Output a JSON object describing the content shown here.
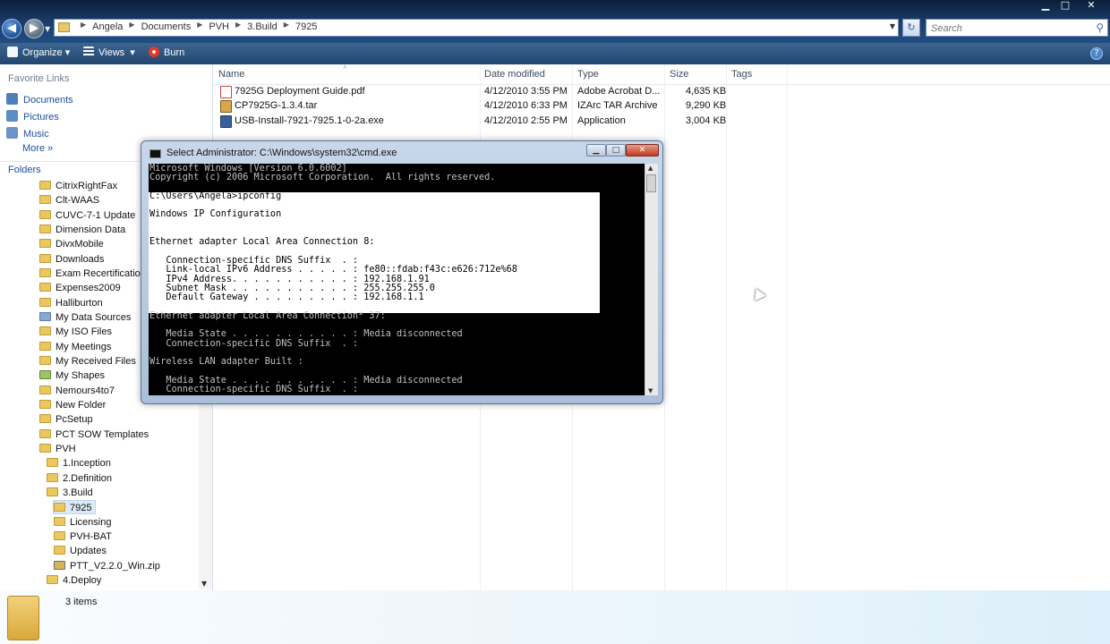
{
  "window": {
    "minimize_glyph": "▁",
    "maximize_glyph": "□",
    "close_glyph": "✕"
  },
  "address_bar": {
    "crumbs": [
      "Angela",
      "Documents",
      "PVH",
      "3.Build",
      "7925"
    ],
    "search_placeholder": "Search"
  },
  "toolbar": {
    "organize": "Organize",
    "views": "Views",
    "burn": "Burn"
  },
  "favorites": {
    "heading": "Favorite Links",
    "items": [
      "Documents",
      "Pictures",
      "Music"
    ],
    "more": "More"
  },
  "folders": {
    "heading": "Folders",
    "items": [
      "CitrixRightFax",
      "Clt-WAAS",
      "CUVC-7-1 Update",
      "Dimension Data",
      "DivxMobile",
      "Downloads",
      "Exam Recertification",
      "Expenses2009",
      "Halliburton",
      "My Data Sources",
      "My ISO Files",
      "My Meetings",
      "My Received Files",
      "My Shapes",
      "Nemours4to7",
      "New Folder",
      "PcSetup",
      "PCT SOW Templates",
      "PVH",
      "1.Inception",
      "2.Definition",
      "3.Build",
      "7925",
      "Licensing",
      "PVH-BAT",
      "Updates",
      "PTT_V2.2.0_Win.zip",
      "4.Deploy"
    ]
  },
  "columns": {
    "name": "Name",
    "date": "Date modified",
    "type": "Type",
    "size": "Size",
    "tags": "Tags"
  },
  "files": [
    {
      "name": "7925G Deployment Guide.pdf",
      "date": "4/12/2010 3:55 PM",
      "type": "Adobe Acrobat D...",
      "size": "4,635 KB"
    },
    {
      "name": "CP7925G-1.3.4.tar",
      "date": "4/12/2010 6:33 PM",
      "type": "IZArc TAR Archive",
      "size": "9,290 KB"
    },
    {
      "name": "USB-Install-7921-7925.1-0-2a.exe",
      "date": "4/12/2010 2:55 PM",
      "type": "Application",
      "size": "3,004 KB"
    }
  ],
  "status": {
    "items": "3 items"
  },
  "cmd": {
    "title": "Select Administrator: C:\\Windows\\system32\\cmd.exe",
    "output": "Microsoft Windows [Version 6.0.6002]\nCopyright (c) 2006 Microsoft Corporation.  All rights reserved.\n\nC:\\Users\\Angela>ipconfig\n\nWindows IP Configuration\n\n\nEthernet adapter Local Area Connection 8:\n\n   Connection-specific DNS Suffix  . :\n   Link-local IPv6 Address . . . . . : fe80::fdab:f43c:e626:712e%68\n   IPv4 Address. . . . . . . . . . . : 192.168.1.91\n   Subnet Mask . . . . . . . . . . . : 255.255.255.0\n   Default Gateway . . . . . . . . . : 192.168.1.1\n\nEthernet adapter Local Area Connection* 37:\n\n   Media State . . . . . . . . . . . : Media disconnected\n   Connection-specific DNS Suffix  . :\n\nWireless LAN adapter Built :\n\n   Media State . . . . . . . . . . . : Media disconnected\n   Connection-specific DNS Suffix  . :"
  },
  "colors": {
    "link_blue": "#1b4f9c",
    "folder_yellow": "#e9c862",
    "toolbar_blue": "#2a5480"
  }
}
